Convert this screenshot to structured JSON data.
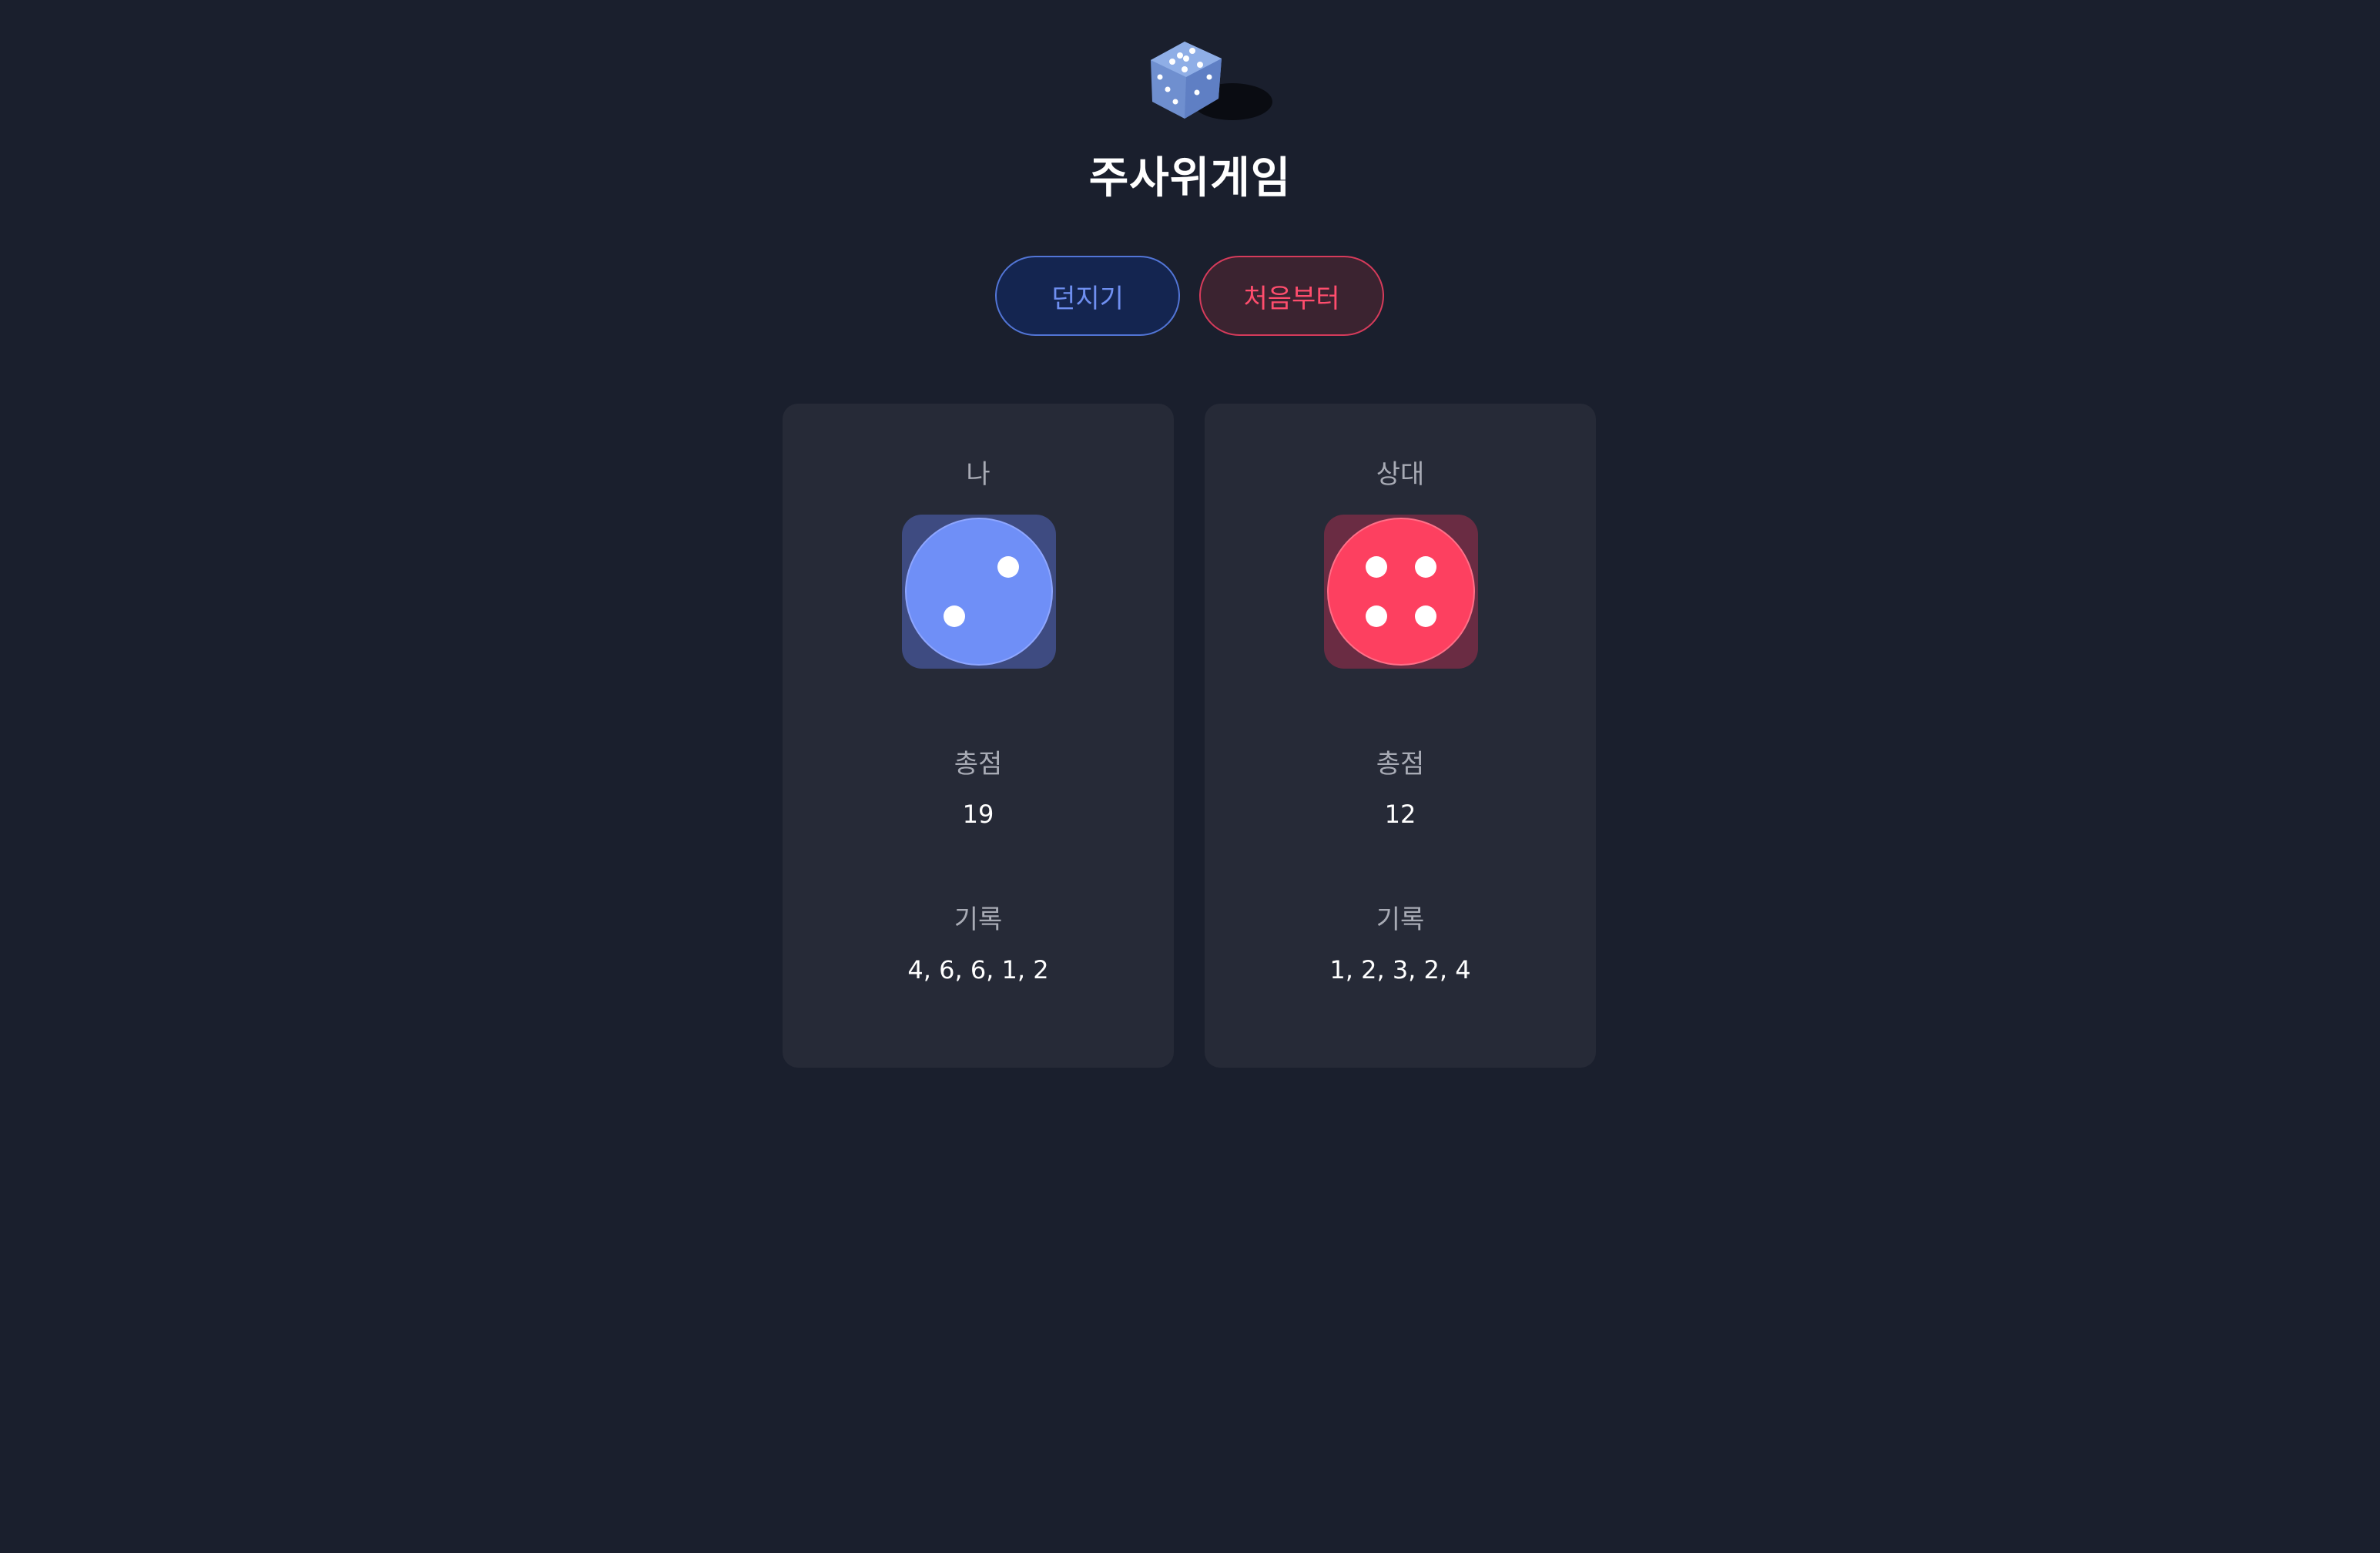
{
  "app": {
    "logo_icon": "dice-icon",
    "title": "주사위게임"
  },
  "controls": {
    "roll_label": "던지기",
    "reset_label": "처음부터"
  },
  "players": {
    "me": {
      "label": "나",
      "die_value": 2,
      "die_color": "#6f8ff7",
      "total_label": "총점",
      "total": "19",
      "history_label": "기록",
      "history": "4, 6, 6, 1, 2"
    },
    "opponent": {
      "label": "상대",
      "die_value": 4,
      "die_color": "#fd4060",
      "total_label": "총점",
      "total": "12",
      "history_label": "기록",
      "history": "1, 2, 3, 2, 4"
    }
  },
  "colors": {
    "background": "#1a1f2d",
    "card": "#262a37",
    "me_accent": "#6f8ff7",
    "opponent_accent": "#ff4d6d"
  }
}
